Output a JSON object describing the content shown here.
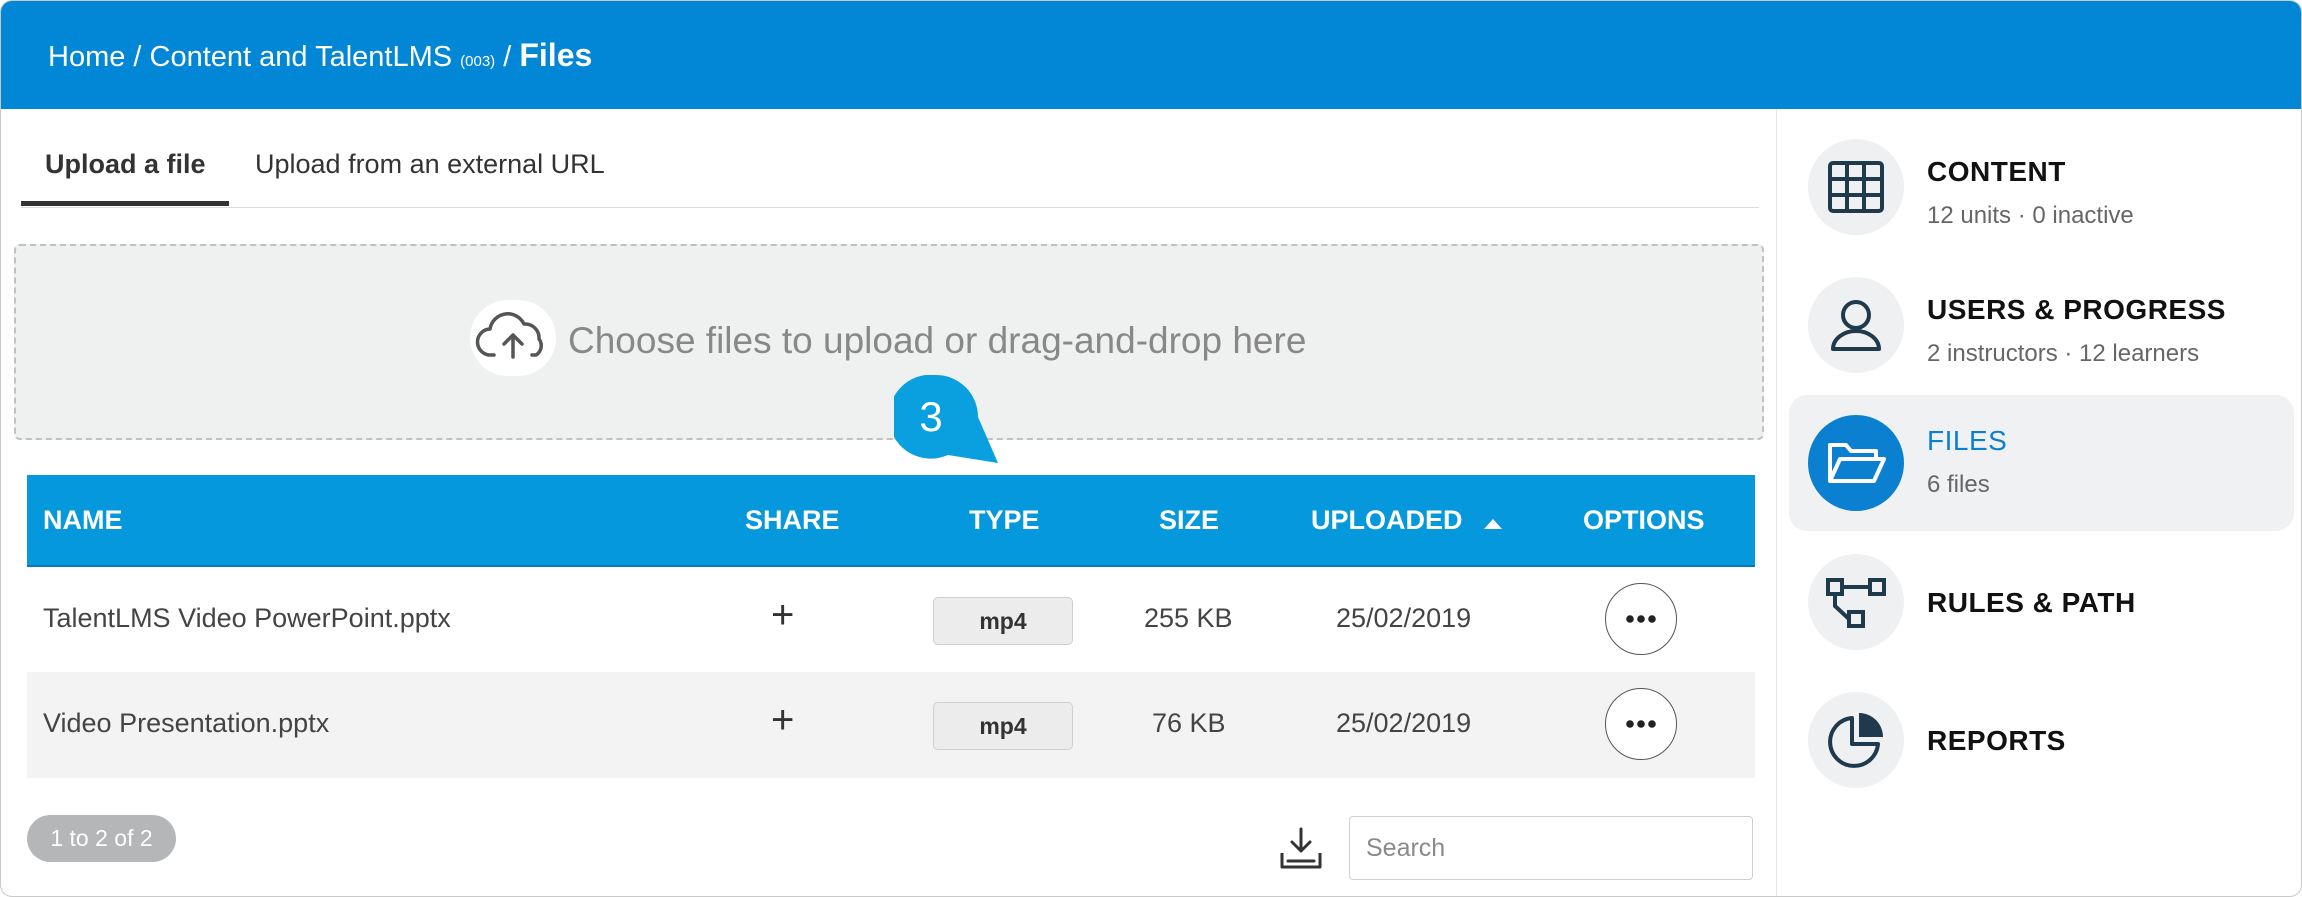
{
  "breadcrumb": {
    "home": "Home",
    "sep1": " / ",
    "course": "Content and TalentLMS",
    "course_code": "(003)",
    "sep2": " / ",
    "current": "Files"
  },
  "tabs": [
    {
      "label": "Upload a file",
      "active": true
    },
    {
      "label": "Upload from an external URL",
      "active": false
    }
  ],
  "dropzone": {
    "text": "Choose files to upload or drag-and-drop here",
    "icon": "cloud-upload-icon"
  },
  "marker": {
    "number": "3"
  },
  "table": {
    "headers": {
      "name": "NAME",
      "share": "SHARE",
      "type": "TYPE",
      "size": "SIZE",
      "uploaded": "UPLOADED",
      "options": "OPTIONS"
    },
    "sort": {
      "column": "uploaded",
      "direction": "ascending"
    },
    "rows": [
      {
        "name": "TalentLMS Video PowerPoint.pptx",
        "share": "+",
        "type": "mp4",
        "size": "255 KB",
        "uploaded": "25/02/2019"
      },
      {
        "name": "Video Presentation.pptx",
        "share": "+",
        "type": "mp4",
        "size": "76 KB",
        "uploaded": "25/02/2019"
      }
    ]
  },
  "footer": {
    "pagination": "1 to 2 of 2",
    "search_placeholder": "Search",
    "export_icon": "download-tray-icon"
  },
  "sidebar": {
    "items": [
      {
        "title": "CONTENT",
        "subtitle": "12 units · 0 inactive",
        "icon": "grid-table-icon",
        "active": false
      },
      {
        "title": "USERS & PROGRESS",
        "subtitle": "2 instructors · 12 learners",
        "icon": "user-icon",
        "active": false
      },
      {
        "title": "FILES",
        "subtitle": "6 files",
        "icon": "folder-open-icon",
        "active": true
      },
      {
        "title": "RULES & PATH",
        "subtitle": "",
        "icon": "flow-path-icon",
        "active": false
      },
      {
        "title": "REPORTS",
        "subtitle": "",
        "icon": "pie-chart-icon",
        "active": false
      }
    ]
  },
  "colors": {
    "header": "#0287d6",
    "table_header": "#0598dc",
    "accent": "#0b7fd0",
    "marker": "#0aa0e0"
  }
}
